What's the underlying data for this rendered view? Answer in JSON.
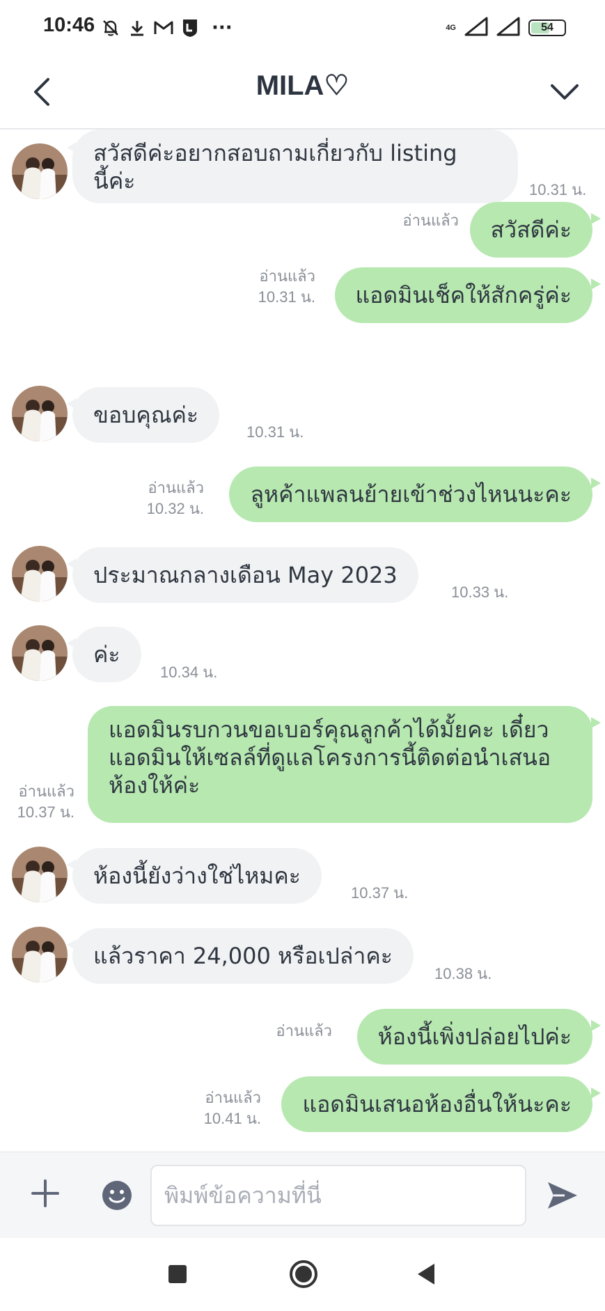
{
  "status_bar": {
    "time": "10:46",
    "network": "4G",
    "battery": "54",
    "more": "···"
  },
  "header": {
    "title": "MILA♡"
  },
  "messages": [
    {
      "side": "in",
      "lines": [
        "สวัสดีค่ะอยากสอบถามเกี่ยวกับ listing",
        "นี้ค่ะ"
      ],
      "time": "10.31 น."
    },
    {
      "side": "out",
      "text": "สวัสดีค่ะ",
      "read": "อ่านแล้ว"
    },
    {
      "side": "out",
      "text": "แอดมินเช็คให้สักครู่ค่ะ",
      "read": "อ่านแล้ว",
      "time": "10.31 น."
    },
    {
      "side": "in",
      "text": "ขอบคุณค่ะ",
      "time": "10.31 น."
    },
    {
      "side": "out",
      "text": "ลูหค้าแพลนย้ายเข้าช่วงไหนนะคะ",
      "read": "อ่านแล้ว",
      "time": "10.32 น."
    },
    {
      "side": "in",
      "text": "ประมาณกลางเดือน May 2023",
      "time": "10.33 น."
    },
    {
      "side": "in",
      "text": "ค่ะ",
      "time": "10.34 น."
    },
    {
      "side": "out",
      "lines": [
        "แอดมินรบกวนขอเบอร์คุณลูกค้าได้มั้ยคะ เดี๋ยว",
        "แอดมินให้เซลล์ที่ดูแลโครงการนี้ติดต่อนำเสนอ",
        "ห้องให้ค่ะ"
      ],
      "read": "อ่านแล้ว",
      "time": "10.37 น."
    },
    {
      "side": "in",
      "text": "ห้องนี้ยังว่างใช่ไหมคะ",
      "time": "10.37 น."
    },
    {
      "side": "in",
      "text": "แล้วราคา 24,000 หรือเปล่าคะ",
      "time": "10.38 น."
    },
    {
      "side": "out",
      "text": "ห้องนี้เพิ่งปล่อยไปค่ะ",
      "read": "อ่านแล้ว"
    },
    {
      "side": "out",
      "text": "แอดมินเสนอห้องอื่นให้นะคะ",
      "read": "อ่านแล้ว",
      "time": "10.41 น."
    }
  ],
  "input": {
    "placeholder": "พิมพ์ข้อความที่นี่"
  },
  "icons": {
    "back": "chevron-left-icon",
    "menu": "chevron-down-icon",
    "plus": "plus-icon",
    "emoji": "smiley-icon",
    "send": "send-icon"
  },
  "colors": {
    "outgoing_bubble": "#b6e8b0",
    "incoming_bubble": "#f1f2f4",
    "icon": "#5f6678"
  }
}
